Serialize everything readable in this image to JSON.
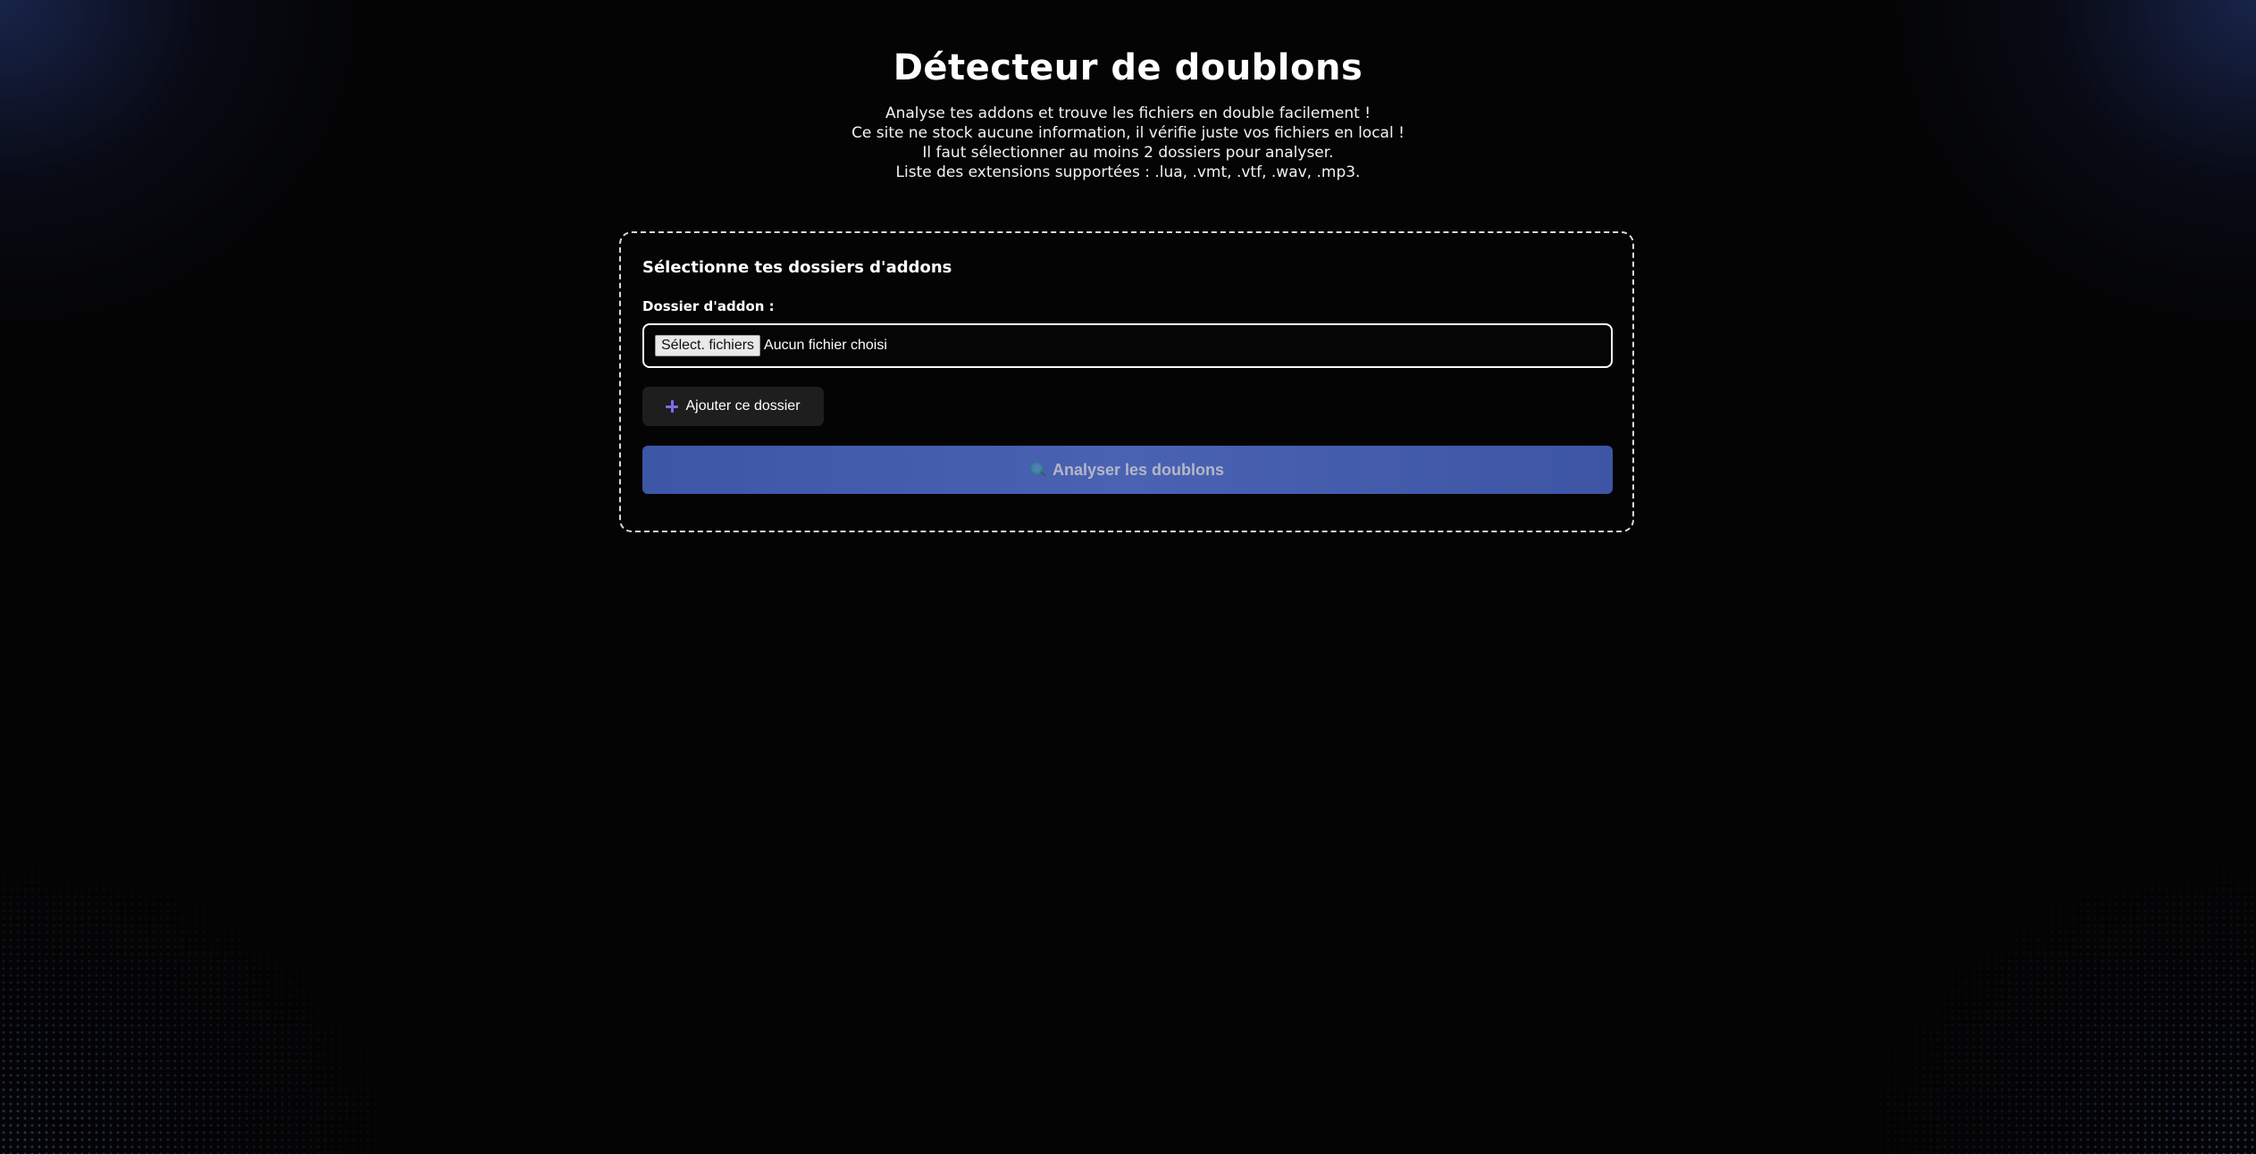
{
  "header": {
    "title": "Détecteur de doublons",
    "description_lines": [
      "Analyse tes addons et trouve les fichiers en double facilement !",
      "Ce site ne stock aucune information, il vérifie juste vos fichiers en local !",
      "Il faut sélectionner au moins 2 dossiers pour analyser.",
      "Liste des extensions supportées : .lua, .vmt, .vtf, .wav, .mp3."
    ]
  },
  "card": {
    "title": "Sélectionne tes dossiers d'addons",
    "field_label": "Dossier d'addon :",
    "file_input": {
      "button_label": "Sélect. fichiers",
      "status": "Aucun fichier choisi"
    },
    "add_button_label": "Ajouter ce dossier",
    "analyze_button_label": "Analyser les doublons"
  },
  "icons": {
    "add": "plus-icon",
    "analyze": "search-icon"
  },
  "colors": {
    "background": "#040404",
    "accent": "#7b6cf0",
    "analyze_button": "#4a62b2",
    "card_border": "#d9d9d9"
  }
}
